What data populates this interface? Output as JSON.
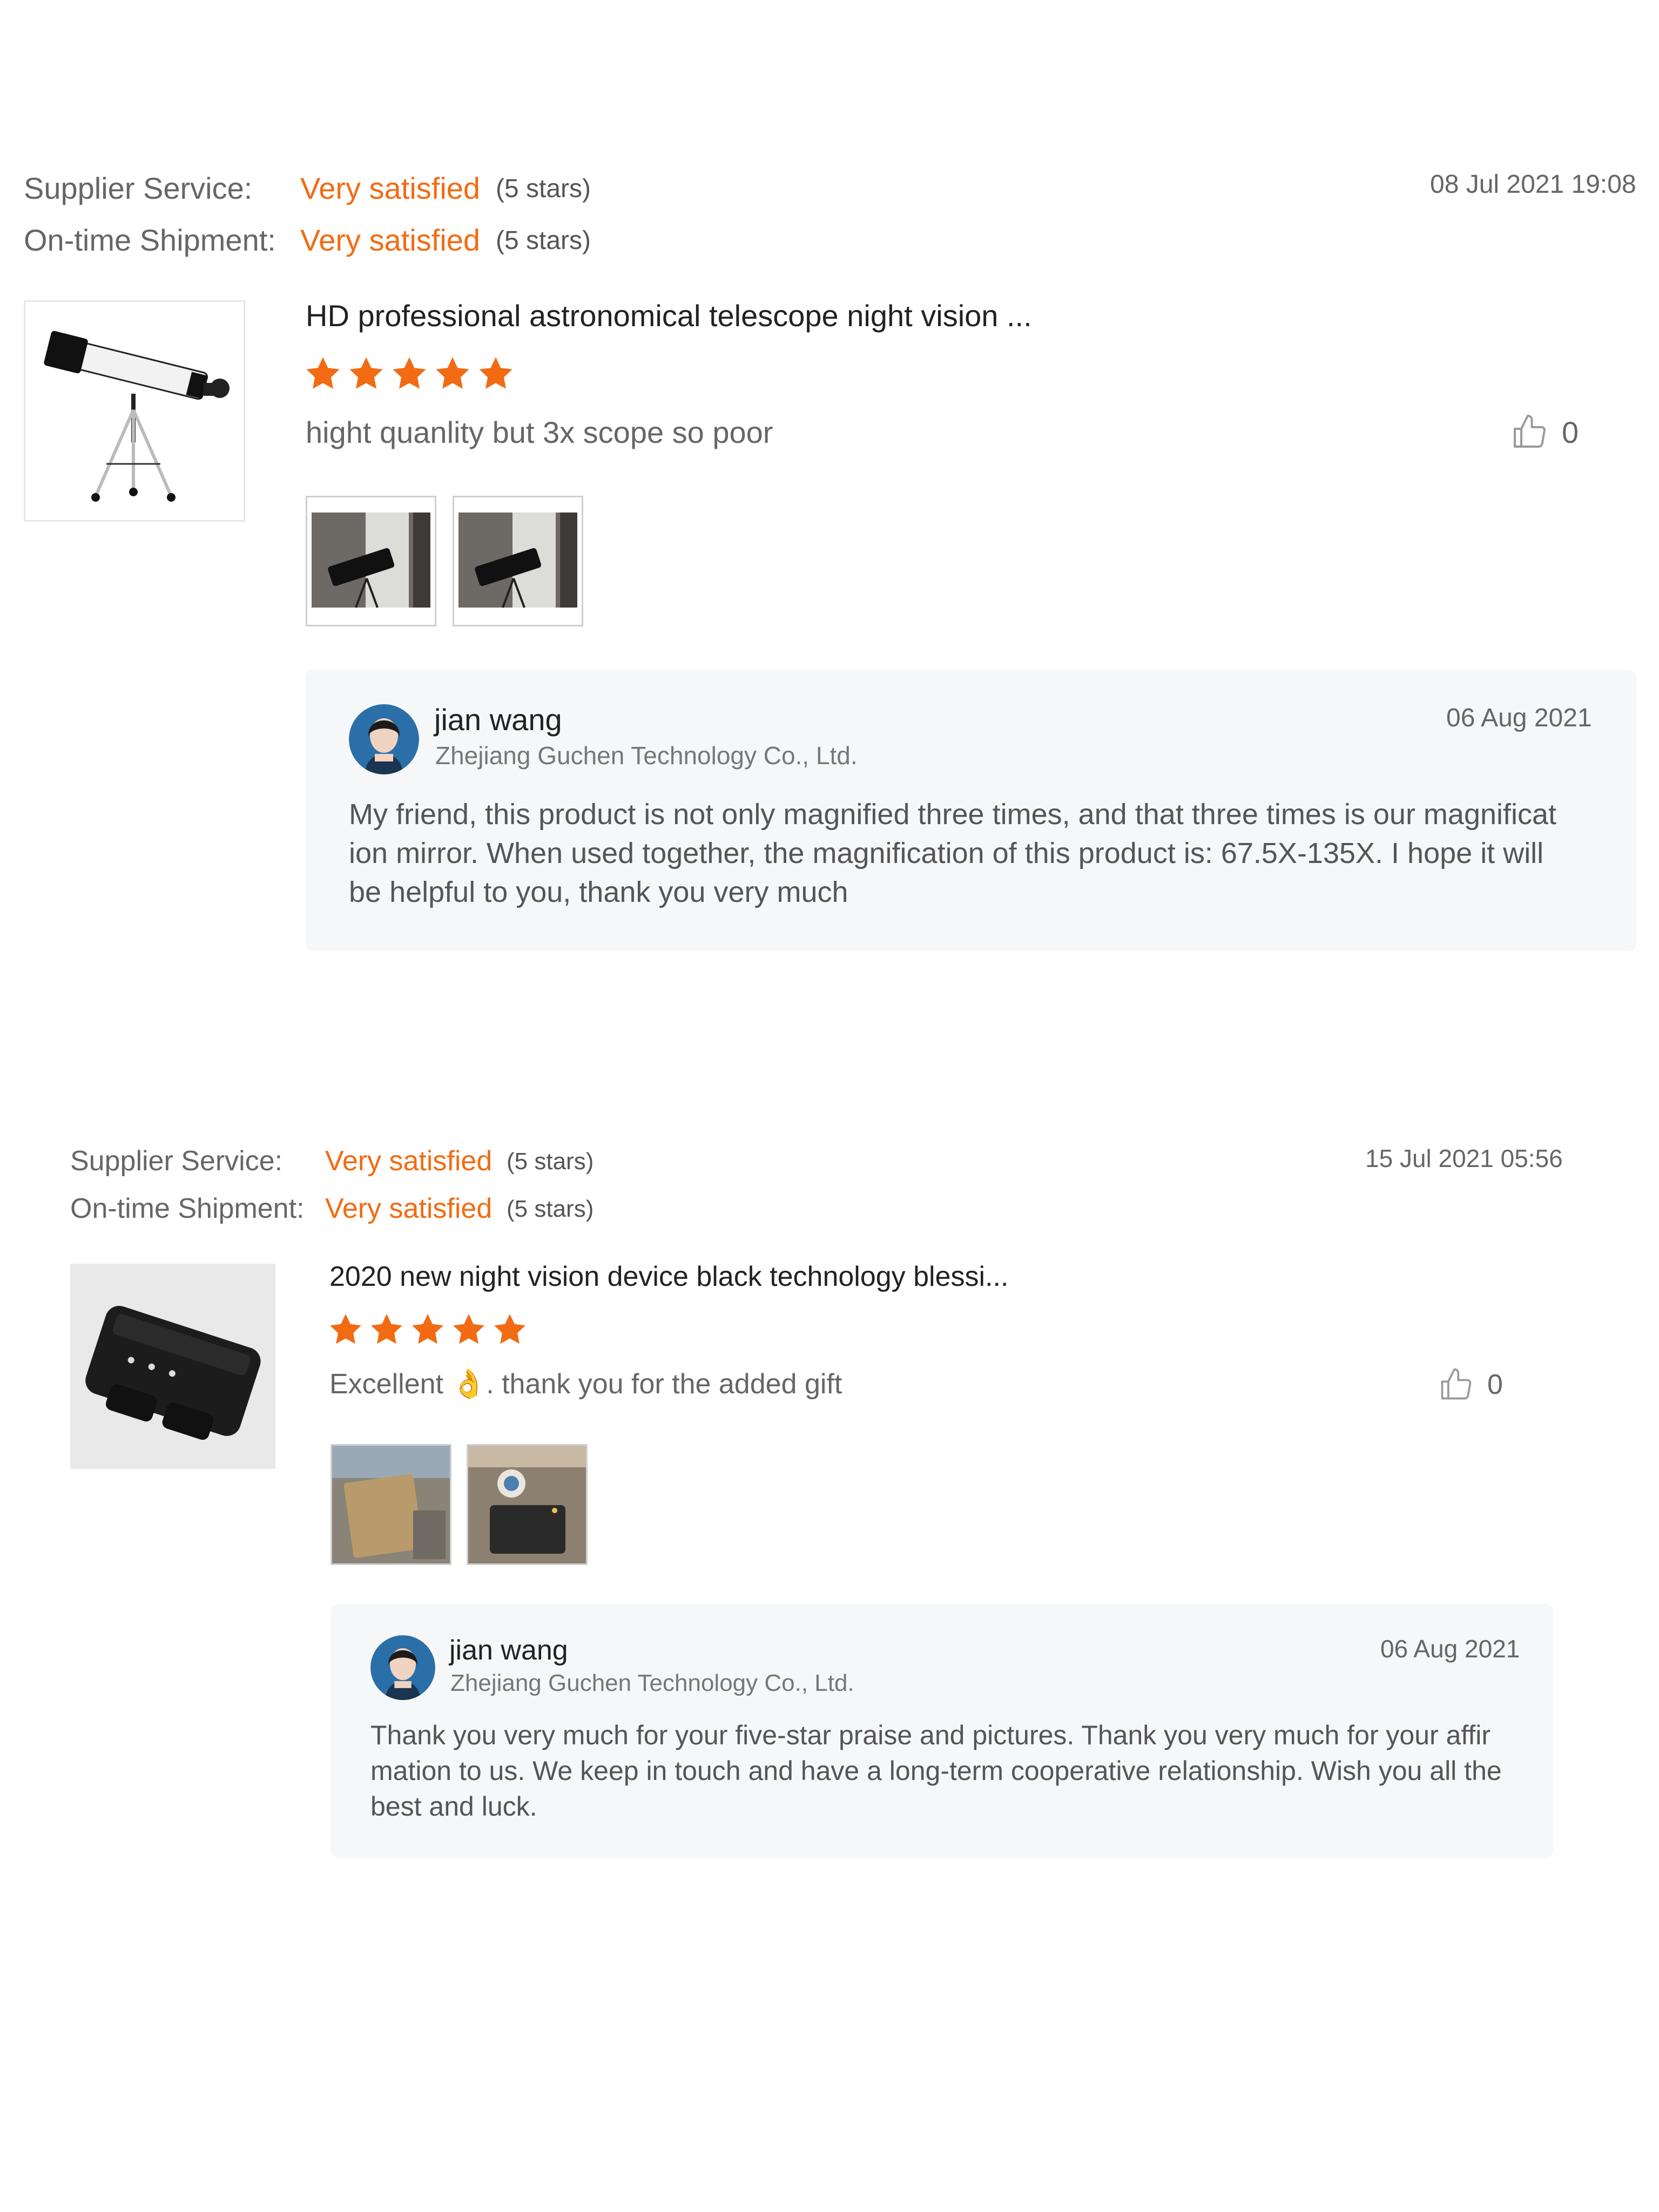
{
  "reviews": [
    {
      "supplier_service_label": "Supplier Service:",
      "supplier_service_value": "Very satisfied",
      "supplier_service_stars": "(5 stars)",
      "shipment_label": "On-time Shipment:",
      "shipment_value": "Very satisfied",
      "shipment_stars": "(5 stars)",
      "date": "08 Jul 2021 19:08",
      "product_title": "HD professional astronomical telescope night vision ...",
      "rating": 5,
      "comment": "hight quanlity but 3x scope so poor",
      "likes": "0",
      "reply": {
        "name": "jian wang",
        "company": "Zhejiang Guchen Technology Co., Ltd.",
        "date": "06 Aug 2021",
        "text": "My friend, this product is not only magnified three times, and that three times is our magnificat ion mirror. When used together, the magnification of this product is: 67.5X-135X. I hope it will be helpful to you, thank you very much"
      }
    },
    {
      "supplier_service_label": "Supplier Service:",
      "supplier_service_value": "Very satisfied",
      "supplier_service_stars": "(5 stars)",
      "shipment_label": "On-time Shipment:",
      "shipment_value": "Very satisfied",
      "shipment_stars": "(5 stars)",
      "date": "15 Jul 2021 05:56",
      "product_title": "2020 new night vision device black technology blessi...",
      "rating": 5,
      "comment": "Excellent 👌. thank you for the added gift",
      "likes": "0",
      "reply": {
        "name": "jian wang",
        "company": "Zhejiang Guchen Technology Co., Ltd.",
        "date": "06 Aug 2021",
        "text": "Thank you very much for your five-star praise and pictures. Thank you very much for your affir mation to us. We keep in touch and have a long-term cooperative relationship. Wish you all the best and luck."
      }
    }
  ],
  "colors": {
    "accent": "#f26b13",
    "star": "#f26b13",
    "reply_bg": "#f6f7f9"
  },
  "icons": {
    "like": "thumbs-up-icon",
    "star": "star-icon"
  }
}
